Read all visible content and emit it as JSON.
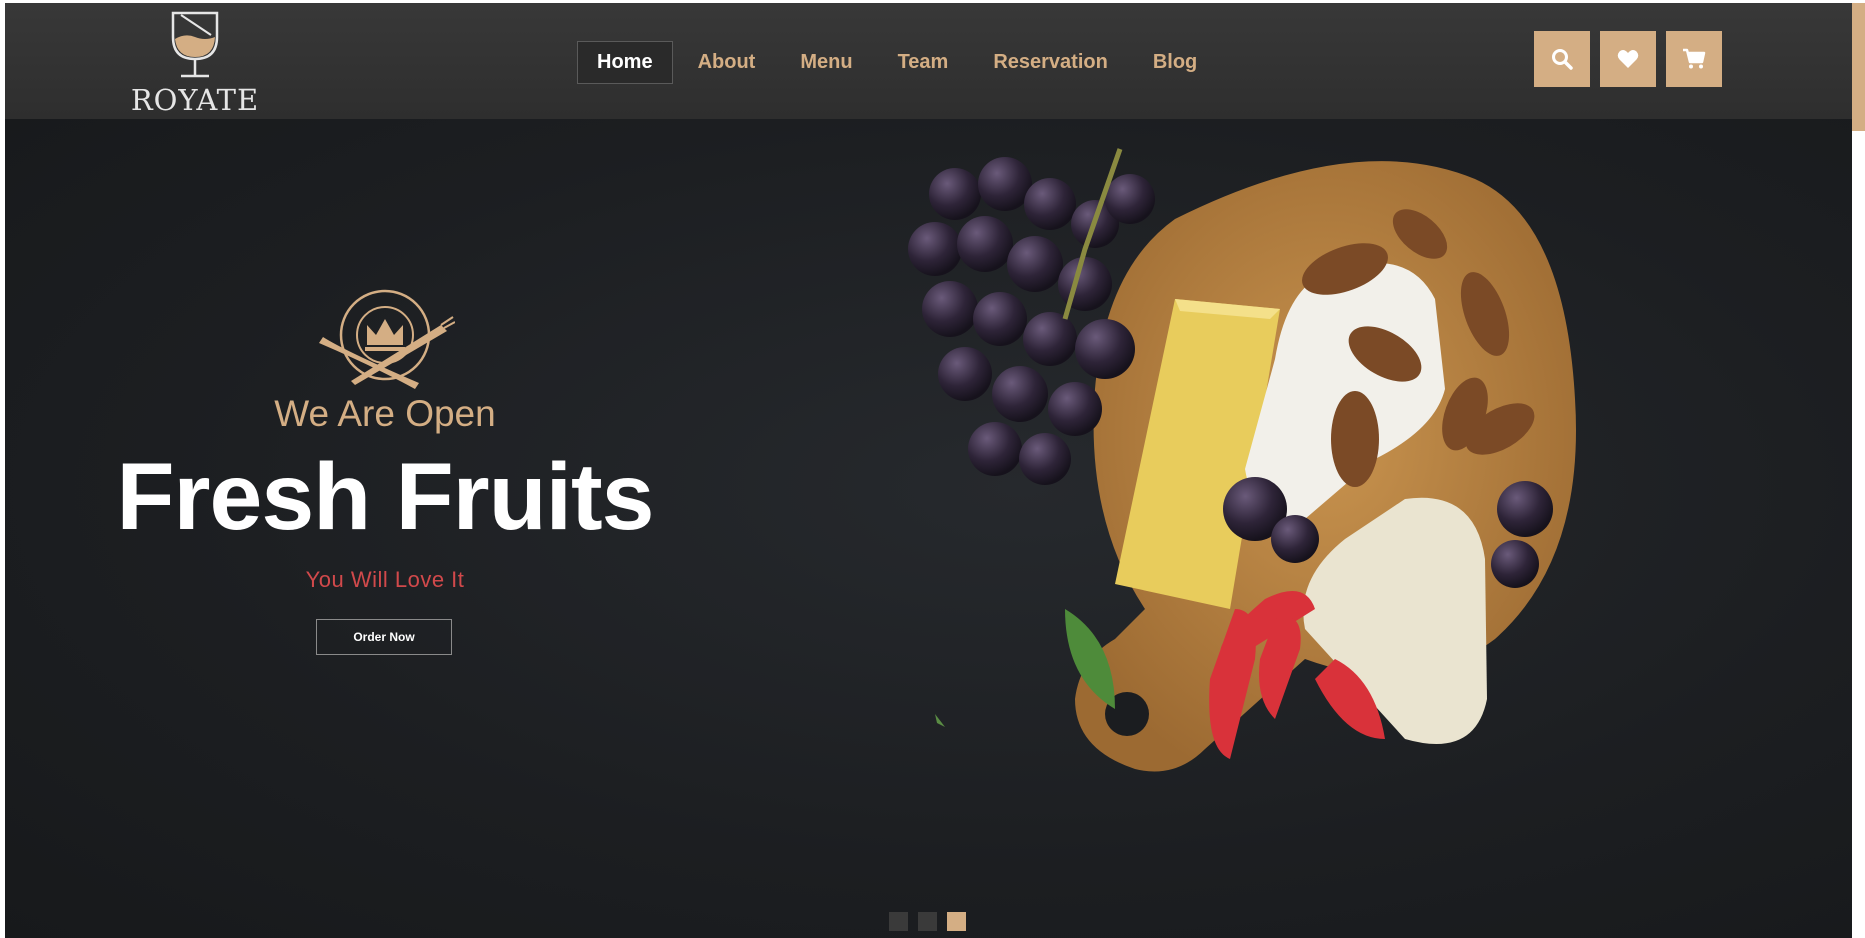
{
  "brand": {
    "name": "ROYATE"
  },
  "nav": {
    "items": [
      {
        "label": "Home",
        "active": true
      },
      {
        "label": "About",
        "active": false
      },
      {
        "label": "Menu",
        "active": false
      },
      {
        "label": "Team",
        "active": false
      },
      {
        "label": "Reservation",
        "active": false
      },
      {
        "label": "Blog",
        "active": false
      }
    ]
  },
  "header_icons": [
    "search-icon",
    "heart-icon",
    "cart-icon"
  ],
  "hero": {
    "tagline": "We Are Open",
    "headline": "Fresh Fruits",
    "subline": "You Will Love It",
    "cta_label": "Order Now"
  },
  "slider": {
    "count": 3,
    "active_index": 3
  },
  "colors": {
    "accent": "#d4ae84",
    "header_bg": "#333333",
    "hero_bg": "#1e2023",
    "subline": "#d1494b"
  }
}
